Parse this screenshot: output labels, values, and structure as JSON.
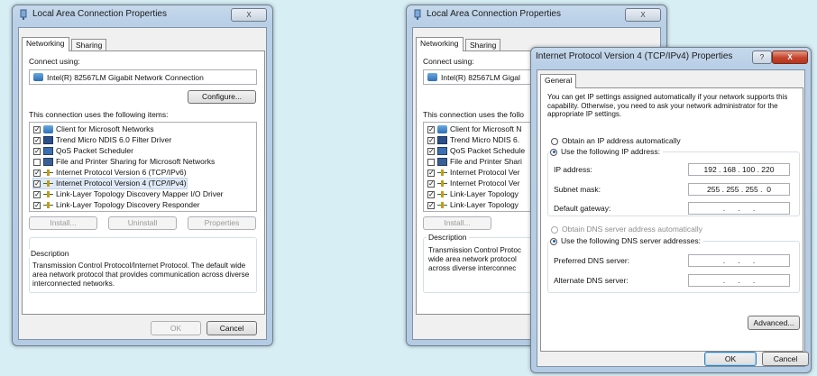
{
  "left_dialog": {
    "title": "Local Area Connection Properties",
    "close_label": "X",
    "tabs": [
      "Networking",
      "Sharing"
    ],
    "connect_using_label": "Connect using:",
    "adapter_name": "Intel(R) 82567LM Gigabit Network Connection",
    "configure_label": "Configure...",
    "items_label": "This connection uses the following items:",
    "items": [
      {
        "label": "Client for Microsoft Networks",
        "checked": true,
        "icon": "network-client-icon"
      },
      {
        "label": "Trend Micro NDIS 6.0 Filter Driver",
        "checked": true,
        "icon": "monitor-icon"
      },
      {
        "label": "QoS Packet Scheduler",
        "checked": true,
        "icon": "qos-icon"
      },
      {
        "label": "File and Printer Sharing for Microsoft Networks",
        "checked": false,
        "icon": "file-printer-icon"
      },
      {
        "label": "Internet Protocol Version 6 (TCP/IPv6)",
        "checked": true,
        "icon": "protocol-icon"
      },
      {
        "label": "Internet Protocol Version 4 (TCP/IPv4)",
        "checked": true,
        "icon": "protocol-icon"
      },
      {
        "label": "Link-Layer Topology Discovery Mapper I/O Driver",
        "checked": true,
        "icon": "protocol-icon"
      },
      {
        "label": "Link-Layer Topology Discovery Responder",
        "checked": true,
        "icon": "protocol-icon"
      }
    ],
    "install_label": "Install...",
    "uninstall_label": "Uninstall",
    "properties_label": "Properties",
    "description_legend": "Description",
    "description_text": "Transmission Control Protocol/Internet Protocol. The default wide area network protocol that provides communication across diverse interconnected networks.",
    "ok_label": "OK",
    "cancel_label": "Cancel"
  },
  "back_dialog": {
    "title": "Local Area Connection Properties",
    "tabs": [
      "Networking",
      "Sharing"
    ],
    "connect_using_label": "Connect using:",
    "adapter_name": "Intel(R) 82567LM Gigal",
    "items_label": "This connection uses the follo",
    "items": [
      {
        "label": "Client for Microsoft N",
        "checked": true,
        "icon": "network-client-icon"
      },
      {
        "label": "Trend Micro NDIS 6.",
        "checked": true,
        "icon": "monitor-icon"
      },
      {
        "label": "QoS Packet Schedule",
        "checked": true,
        "icon": "qos-icon"
      },
      {
        "label": "File and Printer Shari",
        "checked": false,
        "icon": "file-printer-icon"
      },
      {
        "label": "Internet Protocol Ver",
        "checked": true,
        "icon": "protocol-icon"
      },
      {
        "label": "Internet Protocol Ver",
        "checked": true,
        "icon": "protocol-icon"
      },
      {
        "label": "Link-Layer Topology",
        "checked": true,
        "icon": "protocol-icon"
      },
      {
        "label": "Link-Layer Topology",
        "checked": true,
        "icon": "protocol-icon"
      }
    ],
    "install_label": "Install...",
    "description_legend": "Description",
    "description_text": "Transmission Control Protoc wide area network protocol across diverse interconnec"
  },
  "ipv4_dialog": {
    "title": "Internet Protocol Version 4 (TCP/IPv4) Properties",
    "help_label": "?",
    "close_label": "X",
    "tab": "General",
    "intro": "You can get IP settings assigned automatically if your network supports this capability. Otherwise, you need to ask your network administrator for the appropriate IP settings.",
    "obtain_ip_auto": "Obtain an IP address automatically",
    "use_following_ip": "Use the following IP address:",
    "ip_address_label": "IP address:",
    "ip_address_value": "192 . 168 . 100 . 220",
    "subnet_mask_label": "Subnet mask:",
    "subnet_mask_value": "255 . 255 . 255 .  0",
    "default_gateway_label": "Default gateway:",
    "default_gateway_value": ".      .      .",
    "obtain_dns_auto": "Obtain DNS server address automatically",
    "use_following_dns": "Use the following DNS server addresses:",
    "preferred_dns_label": "Preferred DNS server:",
    "preferred_dns_value": ".      .      .",
    "alternate_dns_label": "Alternate DNS server:",
    "alternate_dns_value": ".      .      .",
    "advanced_label": "Advanced...",
    "ok_label": "OK",
    "cancel_label": "Cancel"
  }
}
